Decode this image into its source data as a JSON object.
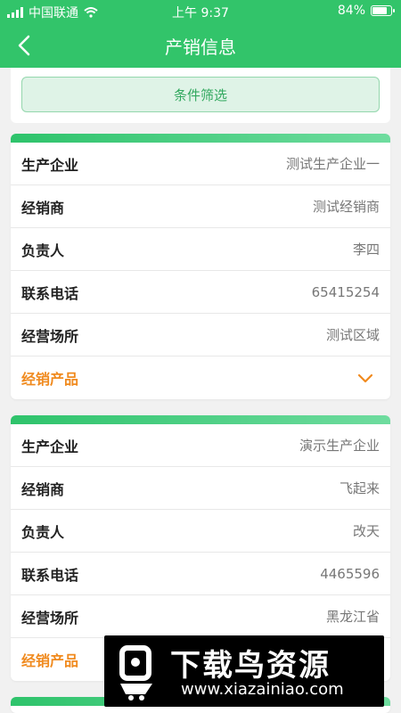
{
  "status_bar": {
    "carrier": "中国联通",
    "time": "上午 9:37",
    "battery": "84%",
    "battery_level": 0.84
  },
  "nav": {
    "title": "产销信息",
    "back_icon": "chevron-left-icon"
  },
  "filter": {
    "label": "条件筛选"
  },
  "cards": [
    {
      "rows": [
        {
          "label": "生产企业",
          "value": "测试生产企业一"
        },
        {
          "label": "经销商",
          "value": "测试经销商"
        },
        {
          "label": "负责人",
          "value": "李四"
        },
        {
          "label": "联系电话",
          "value": "65415254"
        },
        {
          "label": "经营场所",
          "value": "测试区域"
        }
      ],
      "product_label": "经销产品"
    },
    {
      "rows": [
        {
          "label": "生产企业",
          "value": "演示生产企业"
        },
        {
          "label": "经销商",
          "value": "飞起来"
        },
        {
          "label": "负责人",
          "value": "改天"
        },
        {
          "label": "联系电话",
          "value": "4465596"
        },
        {
          "label": "经营场所",
          "value": "黑龙江省"
        }
      ],
      "product_label": "经销产品"
    }
  ],
  "watermark": {
    "title": "下载鸟资源",
    "url": "www.xiazainiao.com"
  },
  "colors": {
    "primary": "#32c46a",
    "accent": "#f08a1e"
  }
}
